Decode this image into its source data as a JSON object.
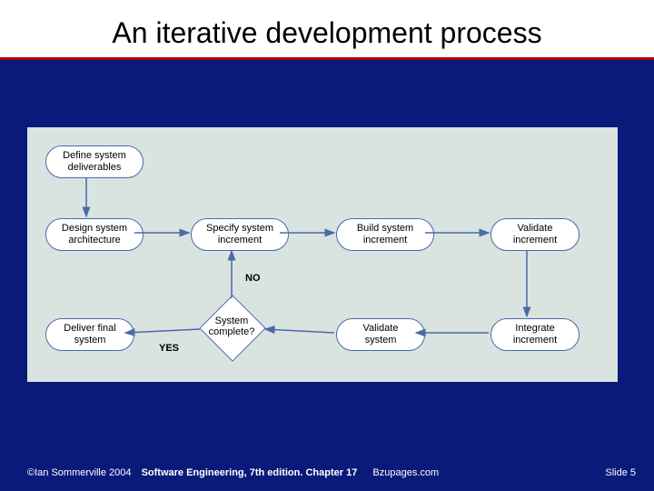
{
  "title": "An iterative development process",
  "nodes": {
    "define": "Define system\ndeliverables",
    "design": "Design system\narchitecture",
    "specify": "Specify system\nincrement",
    "build": "Build system\nincrement",
    "validate_incr": "Validate\nincrement",
    "integrate": "Integrate\nincrement",
    "validate_sys": "Validate\nsystem",
    "decision": "System\ncomplete?",
    "deliver": "Deliver final\nsystem"
  },
  "edge_labels": {
    "no": "NO",
    "yes": "YES"
  },
  "footer": {
    "copyright": "©Ian Sommerville 2004",
    "book": "Software Engineering, 7th edition. Chapter 17",
    "site": "Bzupages.com",
    "slide": "Slide 5"
  }
}
